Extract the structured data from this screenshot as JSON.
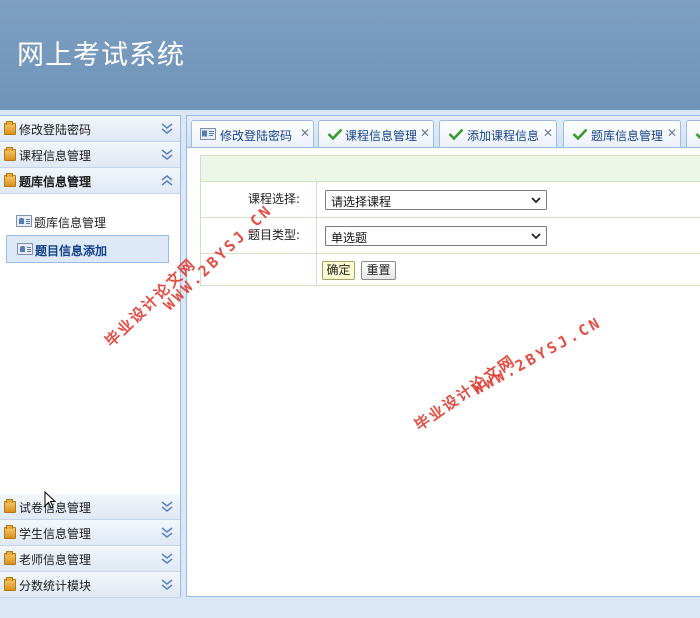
{
  "header": {
    "title": "网上考试系统"
  },
  "sidebar": {
    "sections": [
      {
        "label": "修改登陆密码"
      },
      {
        "label": "课程信息管理"
      },
      {
        "label": "题库信息管理"
      },
      {
        "label": "试卷信息管理"
      },
      {
        "label": "学生信息管理"
      },
      {
        "label": "老师信息管理"
      },
      {
        "label": "分数统计模块"
      }
    ],
    "items": [
      {
        "label": "题库信息管理"
      },
      {
        "label": "题目信息添加"
      }
    ]
  },
  "tabs": [
    {
      "label": "修改登陆密码"
    },
    {
      "label": "课程信息管理"
    },
    {
      "label": "添加课程信息"
    },
    {
      "label": "题库信息管理"
    }
  ],
  "form": {
    "course_label": "课程选择:",
    "course_value": "请选择课程",
    "type_label": "题目类型:",
    "type_value": "单选题",
    "ok_label": "确定",
    "reset_label": "重置"
  },
  "watermarks": {
    "cn": "毕业设计论文网",
    "en": "WWW.2BYSJ.CN"
  },
  "colors": {
    "header_bg": "#7398be",
    "border": "#99bbe8",
    "watermark": "#e03a2f"
  }
}
